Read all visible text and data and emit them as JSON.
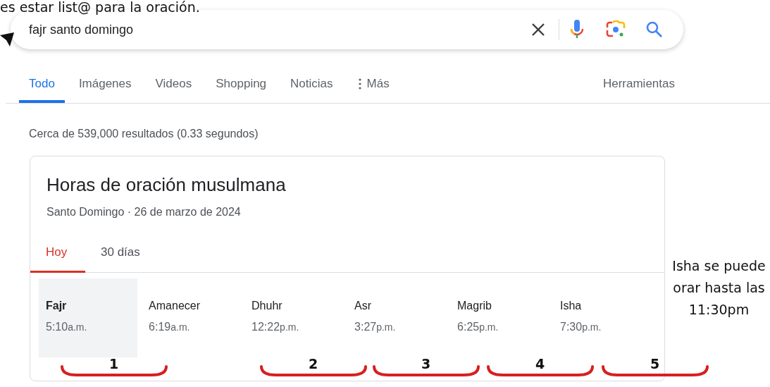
{
  "caption": "es estar list@ para la oración.",
  "search": {
    "value": "fajr santo domingo"
  },
  "tabs": [
    {
      "label": "Todo",
      "selected": true,
      "kind": "tab"
    },
    {
      "label": "Imágenes",
      "selected": false,
      "kind": "tab"
    },
    {
      "label": "Videos",
      "selected": false,
      "kind": "tab"
    },
    {
      "label": "Shopping",
      "selected": false,
      "kind": "tab"
    },
    {
      "label": "Noticias",
      "selected": false,
      "kind": "tab"
    },
    {
      "label": "Más",
      "selected": false,
      "kind": "more"
    }
  ],
  "tools": "Herramientas",
  "result_stats": "Cerca de 539,000 resultados (0.33 segundos)",
  "card": {
    "title": "Horas de oración musulmana",
    "subtitle": "Santo Domingo · 26 de marzo de 2024",
    "tabs": [
      {
        "label": "Hoy",
        "selected": true
      },
      {
        "label": "30 días",
        "selected": false
      }
    ],
    "prayers": [
      {
        "name": "Fajr",
        "time": "5:10",
        "period": "a.m.",
        "selected": true
      },
      {
        "name": "Amanecer",
        "time": "6:19",
        "period": "a.m.",
        "selected": false
      },
      {
        "name": "Dhuhr",
        "time": "12:22",
        "period": "p.m.",
        "selected": false
      },
      {
        "name": "Asr",
        "time": "3:27",
        "period": "p.m.",
        "selected": false
      },
      {
        "name": "Magrib",
        "time": "6:25",
        "period": "p.m.",
        "selected": false
      },
      {
        "name": "Isha",
        "time": "7:30",
        "period": "p.m.",
        "selected": false
      }
    ]
  },
  "annotations": {
    "brackets": [
      "1",
      "2",
      "3",
      "4",
      "5"
    ],
    "note": "Isha se puede orar hasta las 11:30pm"
  }
}
